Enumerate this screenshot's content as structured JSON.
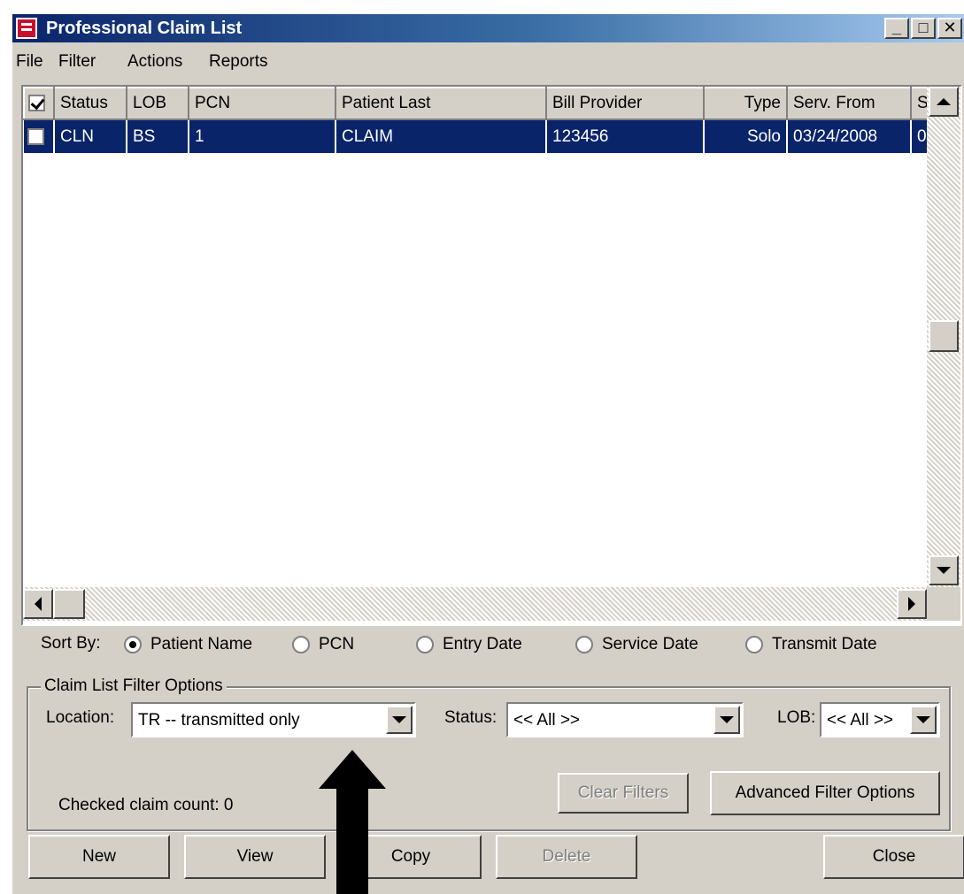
{
  "window": {
    "title": "Professional Claim List",
    "minimize": "_",
    "maximize": "□",
    "close": "✕"
  },
  "menu": [
    {
      "label": "File"
    },
    {
      "label": "Filter"
    },
    {
      "label": "Actions"
    },
    {
      "label": "Reports"
    }
  ],
  "columns": [
    "Status",
    "LOB",
    "PCN",
    "Patient Last",
    "Bill Provider",
    "Type",
    "Serv. From",
    "S"
  ],
  "rows": [
    {
      "checked": false,
      "status": "CLN",
      "lob": "BS",
      "pcn": "1",
      "patient_last": "CLAIM",
      "bill_provider": "123456",
      "type": "Solo",
      "serv_from": "03/24/2008",
      "s": "0"
    }
  ],
  "sort": {
    "label": "Sort By:",
    "options": [
      "Patient Name",
      "PCN",
      "Entry Date",
      "Service Date",
      "Transmit Date"
    ],
    "selected": "Patient Name"
  },
  "filter": {
    "legend": "Claim List Filter Options",
    "location_label": "Location:",
    "location_value": "TR -- transmitted only",
    "status_label": "Status:",
    "status_value": "<< All >>",
    "lob_label": "LOB:",
    "lob_value": "<< All >>",
    "clear_label": "Clear Filters",
    "advanced_label": "Advanced Filter Options",
    "checked_count_text": "Checked claim count: 0"
  },
  "buttons": {
    "new": "New",
    "view": "View",
    "copy": "Copy",
    "delete": "Delete",
    "close": "Close"
  },
  "colors": {
    "title_start": "#0a246a",
    "title_end": "#a6caf0",
    "selection": "#0a246a",
    "face": "#d4d0c8"
  }
}
